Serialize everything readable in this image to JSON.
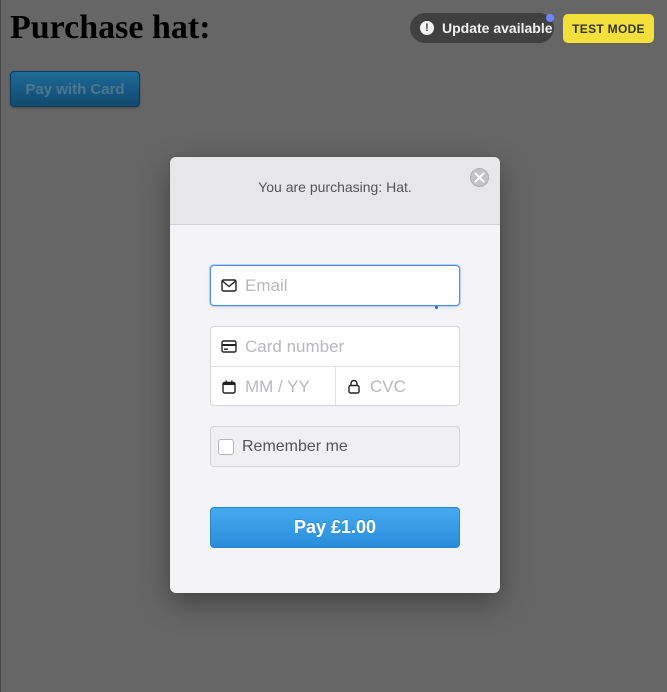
{
  "page": {
    "title": "Purchase hat:",
    "pay_with_card_label": "Pay with Card"
  },
  "badges": {
    "update_label": "Update available",
    "update_icon": "alert-circle-icon",
    "test_mode_label": "TEST MODE"
  },
  "checkout": {
    "subtitle": "You are purchasing: Hat.",
    "close_icon": "close-icon",
    "email": {
      "placeholder": "Email",
      "value": "",
      "icon": "envelope-icon"
    },
    "card_number": {
      "placeholder": "Card number",
      "value": "",
      "icon": "credit-card-icon"
    },
    "expiry": {
      "placeholder": "MM / YY",
      "value": "",
      "icon": "calendar-icon"
    },
    "cvc": {
      "placeholder": "CVC",
      "value": "",
      "icon": "lock-icon"
    },
    "remember_me": {
      "label": "Remember me",
      "checked": false
    },
    "pay_button_label": "Pay £1.00"
  },
  "colors": {
    "background": "#666666",
    "pay_button": "#3a9ce6",
    "test_mode_badge": "#f4e03a",
    "focus_border": "#4e8ce6"
  }
}
